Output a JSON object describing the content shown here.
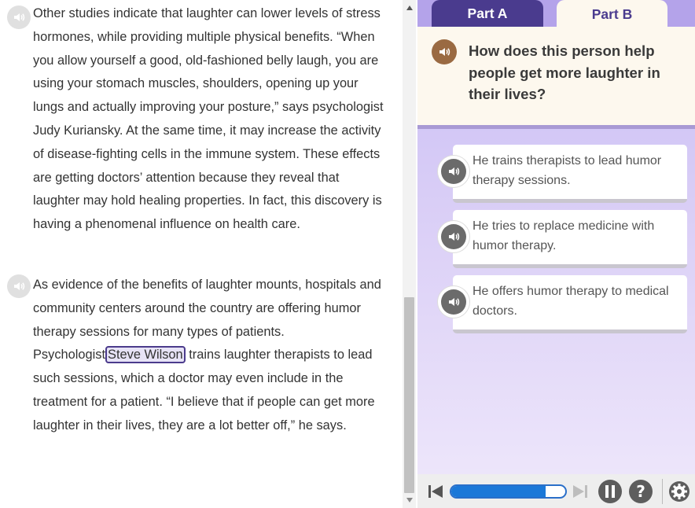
{
  "passage": {
    "paragraphs": [
      {
        "text": "Other studies indicate that laughter can lower levels of stress hormones, while providing multiple physical benefits. “When you allow yourself a good, old-fashioned belly laugh, you are using your stomach muscles, shoulders, opening up your lungs and actually improving your posture,” says psychologist Judy Kuriansky. At the same time, it may increase the activity of disease-fighting cells in the immune system. These effects are getting doctors’ attention because they reveal that laughter may hold healing properties. In fact, this discovery is having a phenomenal influence on health care."
      },
      {
        "before": "As evidence of the benefits of laughter mounts, hospitals and community centers around the country are offering humor therapy sessions for many types of patients. Psychologist",
        "highlight": "Steve Wilson",
        "after": "trains laughter therapists to lead such sessions, which a doctor may even include in the treatment for a patient. “I believe that if people can get more laughter in their lives, they are a lot better off,” he says."
      }
    ]
  },
  "tabs": [
    {
      "label": "Part A",
      "active": false
    },
    {
      "label": "Part B",
      "active": true
    }
  ],
  "question": {
    "text": "How does this person help people get more laughter in their lives?"
  },
  "options": [
    {
      "text": "He trains therapists to lead humor therapy sessions."
    },
    {
      "text": "He tries to replace medicine with humor therapy."
    },
    {
      "text": "He offers humor therapy to medical doctors."
    }
  ],
  "toolbar": {
    "progress": 0.83,
    "help_label": "?"
  },
  "colors": {
    "tab_active_bg": "#fdf8ee",
    "tab_inactive_bg": "#4a3b8e",
    "question_audio": "#9a6a42",
    "progress_fill": "#1b78d8"
  },
  "icons": [
    "speaker-icon",
    "skip-previous-icon",
    "skip-next-icon",
    "pause-icon",
    "help-icon",
    "gear-icon"
  ]
}
